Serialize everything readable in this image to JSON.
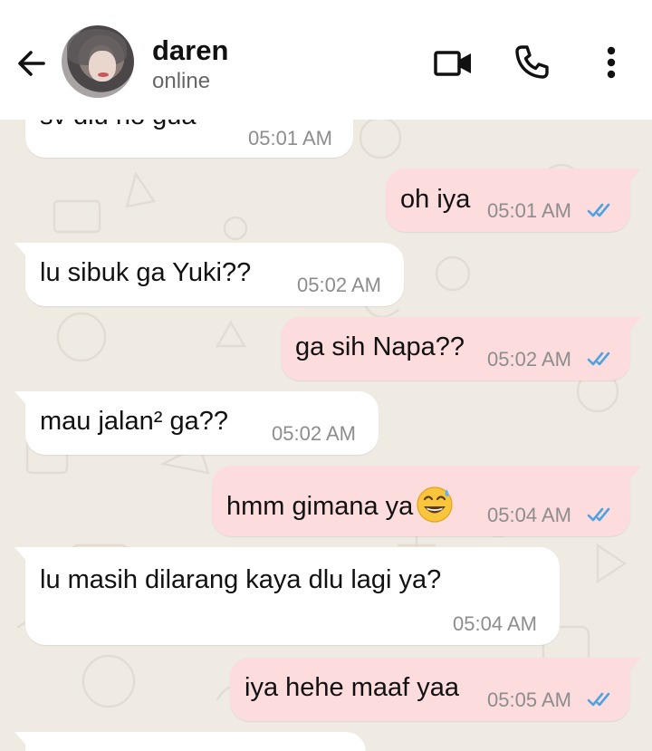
{
  "header": {
    "name": "daren",
    "status": "online",
    "icons": {
      "back": "arrow-back-icon",
      "video": "video-camera-icon",
      "call": "phone-icon",
      "menu": "more-vertical-icon"
    }
  },
  "colors": {
    "incoming_bubble": "#ffffff",
    "outgoing_bubble": "#fcdcdc",
    "read_ticks": "#4fa3e0",
    "wallpaper": "#efeae2"
  },
  "messages": [
    {
      "direction": "in",
      "text": "sv dlu no gua",
      "time": "05:01 AM"
    },
    {
      "direction": "out",
      "text": "oh iya",
      "time": "05:01 AM",
      "status": "read"
    },
    {
      "direction": "in",
      "text": "lu sibuk ga Yuki??",
      "time": "05:02 AM"
    },
    {
      "direction": "out",
      "text": "ga sih Napa??",
      "time": "05:02 AM",
      "status": "read"
    },
    {
      "direction": "in",
      "text": "mau jalan² ga??",
      "time": "05:02 AM"
    },
    {
      "direction": "out",
      "text": "hmm gimana ya",
      "emoji": "grinning-sweat-emoji",
      "time": "05:04 AM",
      "status": "read"
    },
    {
      "direction": "in",
      "text": "lu masih dilarang kaya dlu lagi ya?",
      "time": "05:04 AM"
    },
    {
      "direction": "out",
      "text": "iya hehe maaf yaa",
      "time": "05:05 AM",
      "status": "read"
    }
  ]
}
